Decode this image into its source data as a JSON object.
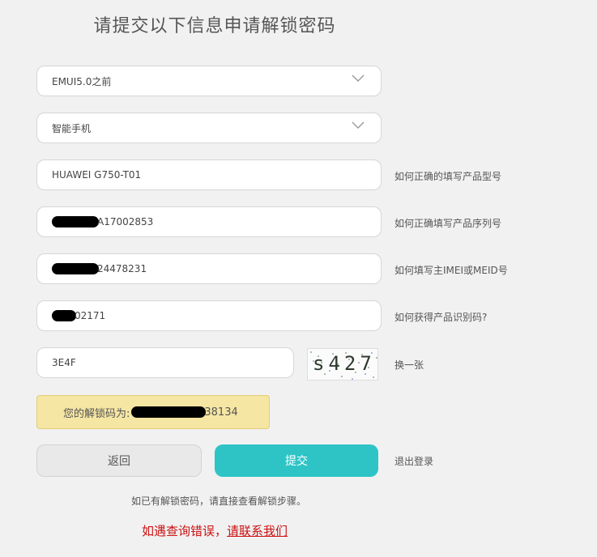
{
  "title": "请提交以下信息申请解锁密码",
  "form": {
    "system_select": "EMUI5.0之前",
    "device_select": "智能手机",
    "model": "HUAWEI G750-T01",
    "serial_suffix": "A17002853",
    "imei_suffix": "24478231",
    "product_id_suffix": "02171",
    "captcha_input": "3E4F",
    "captcha_image_text": "s427"
  },
  "help": {
    "model": "如何正确的填写产品型号",
    "serial": "如何正确填写产品序列号",
    "imei": "如何填写主IMEI或MEID号",
    "product_id": "如何获得产品识别码?",
    "refresh_captcha": "换一张"
  },
  "result": {
    "label": "您的解锁码为:",
    "code_suffix": "38134"
  },
  "buttons": {
    "back": "返回",
    "submit": "提交",
    "logout": "退出登录"
  },
  "footer": {
    "hint": "如已有解锁密码，请直接查看解锁步骤。",
    "contact_prefix": "如遇查询错误，",
    "contact_link": "请联系我们"
  },
  "colors": {
    "accent": "#2ec4c6",
    "result_bg": "#f5e6a3",
    "error": "#cc1111"
  }
}
